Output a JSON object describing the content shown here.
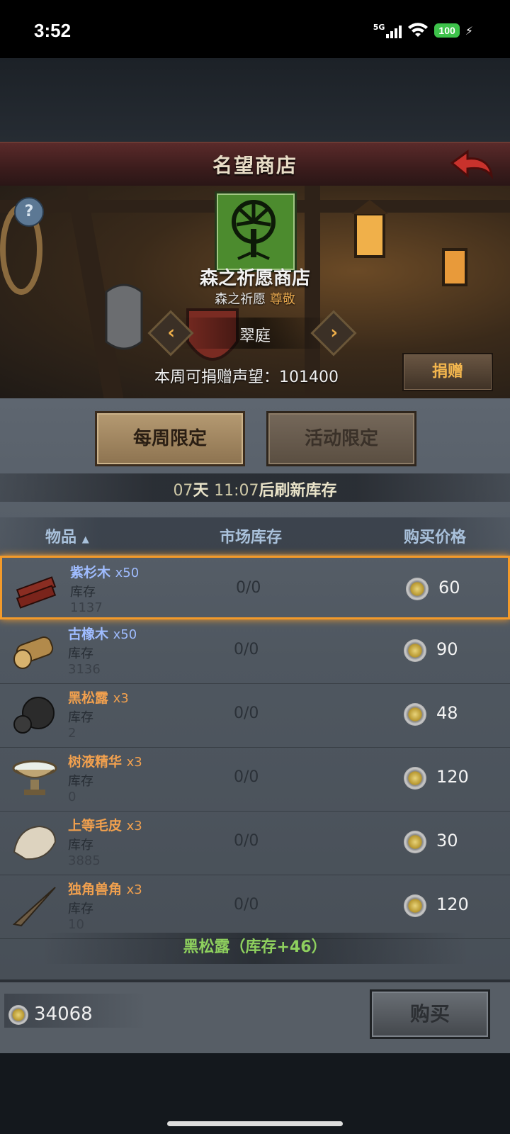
{
  "status": {
    "time": "3:52",
    "network": "5G",
    "battery": "100"
  },
  "header": {
    "title": "名望商店"
  },
  "shop": {
    "name": "森之祈愿商店",
    "faction": "森之祈愿",
    "rank": "尊敬",
    "region": "翠庭",
    "donate_label": "本周可捐赠声望：",
    "donate_value": "101400",
    "donate_button": "捐赠"
  },
  "tabs": [
    {
      "label": "每周限定",
      "active": true
    },
    {
      "label": "活动限定",
      "active": false
    }
  ],
  "refresh": {
    "days": "07",
    "days_unit": "天",
    "time": "11:07",
    "suffix": "后刷新库存"
  },
  "table": {
    "headers": {
      "item": "物品",
      "sort_icon": "▲",
      "market": "市场库存",
      "price": "购买价格"
    },
    "stock_label": "库存",
    "rows": [
      {
        "name": "紫杉木",
        "qty": "x50",
        "stock": "1137",
        "market": "0/0",
        "price": "60",
        "color": "blue",
        "icon": "yew-wood-icon"
      },
      {
        "name": "古橡木",
        "qty": "x50",
        "stock": "3136",
        "market": "0/0",
        "price": "90",
        "color": "blue",
        "icon": "oak-log-icon"
      },
      {
        "name": "黑松露",
        "qty": "x3",
        "stock": "2",
        "market": "0/0",
        "price": "48",
        "color": "orange",
        "icon": "truffle-icon"
      },
      {
        "name": "树液精华",
        "qty": "x3",
        "stock": "0",
        "market": "0/0",
        "price": "120",
        "color": "orange",
        "icon": "sap-bowl-icon"
      },
      {
        "name": "上等毛皮",
        "qty": "x3",
        "stock": "3885",
        "market": "0/0",
        "price": "30",
        "color": "orange",
        "icon": "fur-icon"
      },
      {
        "name": "独角兽角",
        "qty": "x3",
        "stock": "10",
        "market": "0/0",
        "price": "120",
        "color": "orange",
        "icon": "unicorn-horn-icon"
      }
    ]
  },
  "toast": {
    "item": "黑松露",
    "text": "（库存+46）"
  },
  "footer": {
    "money": "34068",
    "buy_button": "购买"
  },
  "colors": {
    "accent": "#f39a2a",
    "blue_item": "#9fbcff",
    "orange_item": "#f1a04e",
    "toast_green": "#8ed05e"
  }
}
